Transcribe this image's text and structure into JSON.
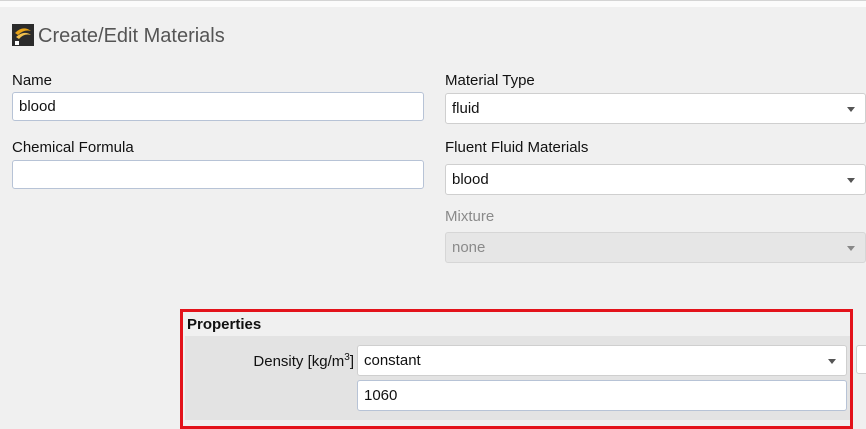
{
  "window": {
    "title": "Create/Edit Materials",
    "icon": "fluent-logo-icon"
  },
  "left": {
    "name_label": "Name",
    "name_value": "blood",
    "formula_label": "Chemical Formula",
    "formula_value": ""
  },
  "right": {
    "material_type_label": "Material Type",
    "material_type_value": "fluid",
    "fluent_materials_label": "Fluent Fluid Materials",
    "fluent_materials_value": "blood",
    "mixture_label": "Mixture",
    "mixture_value": "none"
  },
  "properties": {
    "header": "Properties",
    "density_label_prefix": "Density [kg/m",
    "density_label_sup": "3",
    "density_label_suffix": "]",
    "density_method": "constant",
    "density_value": "1060"
  },
  "colors": {
    "highlight": "#e3131b",
    "input_border": "#b7c3d6"
  }
}
